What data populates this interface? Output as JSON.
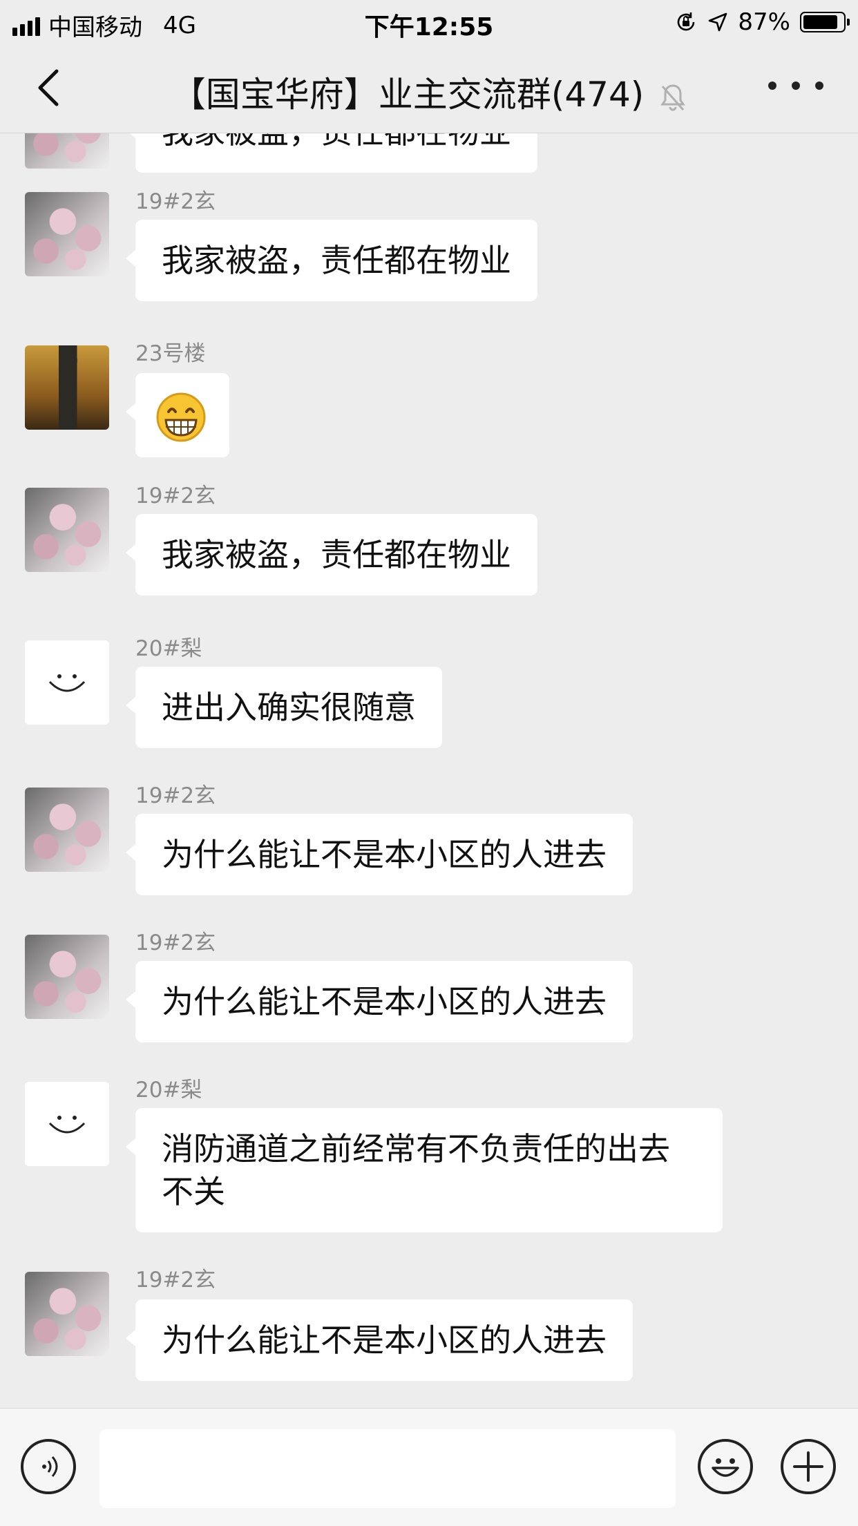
{
  "status_bar": {
    "carrier": "中国移动",
    "network": "4G",
    "time": "下午12:55",
    "battery_text": "87%",
    "battery_level": 0.87,
    "icons": [
      "signal-icon",
      "rotation-lock-icon",
      "location-icon",
      "battery-icon"
    ]
  },
  "nav": {
    "title": "【国宝华府】业主交流群(474)",
    "icons": [
      "back-icon",
      "mute-bell-icon",
      "more-icon"
    ]
  },
  "messages": [
    {
      "sender": "",
      "text": "我家被盗，责任都在物业",
      "avatar": "flower-avatar",
      "partial": true
    },
    {
      "sender": "19#2玄",
      "text": "我家被盗，责任都在物业",
      "avatar": "flower-avatar"
    },
    {
      "sender": "23号楼",
      "text": "",
      "emoji": "grinning-face-emoji",
      "avatar": "movie-avatar"
    },
    {
      "sender": "19#2玄",
      "text": "我家被盗，责任都在物业",
      "avatar": "flower-avatar"
    },
    {
      "sender": "20#梨",
      "text": "进出入确实很随意",
      "avatar": "smile-avatar"
    },
    {
      "sender": "19#2玄",
      "text": "为什么能让不是本小区的人进去",
      "avatar": "flower-avatar"
    },
    {
      "sender": "19#2玄",
      "text": "为什么能让不是本小区的人进去",
      "avatar": "flower-avatar"
    },
    {
      "sender": "20#梨",
      "text": "消防通道之前经常有不负责任的出去不关",
      "avatar": "smile-avatar"
    },
    {
      "sender": "19#2玄",
      "text": "为什么能让不是本小区的人进去",
      "avatar": "flower-avatar"
    }
  ],
  "input_bar": {
    "value": "",
    "icons": [
      "voice-icon",
      "emoji-icon",
      "plus-icon"
    ]
  },
  "colors": {
    "background": "#ededed",
    "bubble": "#ffffff",
    "sender_text": "#8a8a8a"
  }
}
